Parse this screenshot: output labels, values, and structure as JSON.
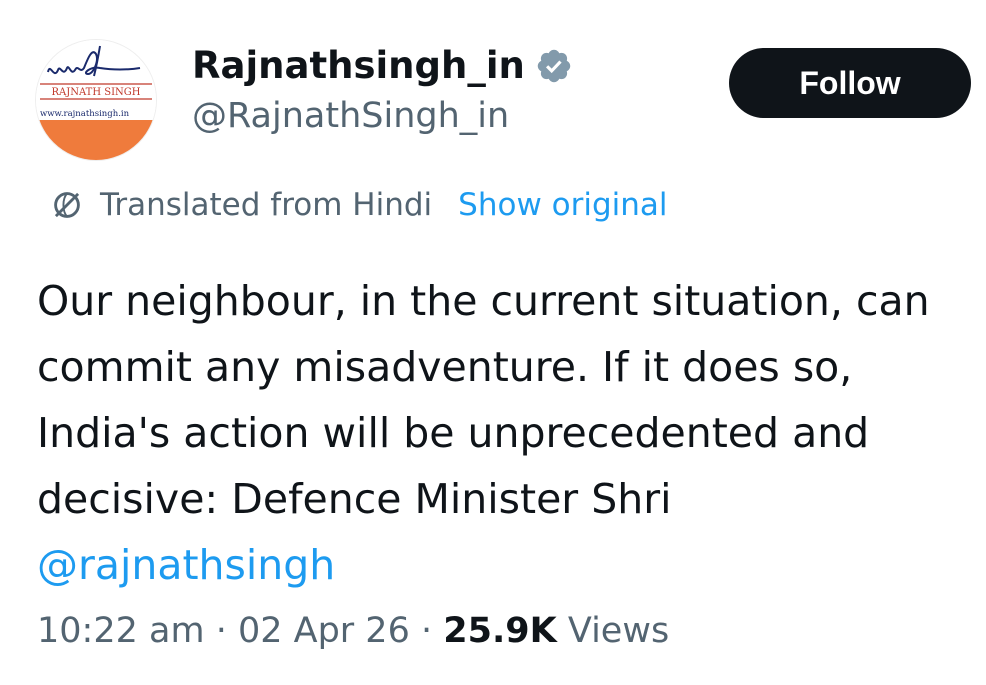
{
  "author": {
    "display_name": "Rajnathsingh_in",
    "handle": "@RajnathSingh_in",
    "verified": true,
    "avatar": {
      "logo_text": "RAJNATH SINGH",
      "url_text": "www.rajnathsingh.in",
      "brand_color": "#ef7b3c"
    }
  },
  "follow_button": {
    "label": "Follow"
  },
  "translation": {
    "note": "Translated from Hindi",
    "show_original_label": "Show original"
  },
  "tweet": {
    "text": "Our neighbour, in the current situation, can commit any misadventure. If it does so, India's action will be unprecedented and decisive: Defence Minister Shri",
    "mention": "@rajnathsingh"
  },
  "meta": {
    "time": "10:22 am",
    "separator": "·",
    "date": "02 Apr 26",
    "views_count": "25.9K",
    "views_label": "Views"
  },
  "colors": {
    "text_primary": "#0f1419",
    "text_secondary": "#536471",
    "link": "#1d9bf0",
    "button_bg": "#0f1419"
  },
  "icons": {
    "verified": "verified-badge-icon",
    "translate": "globe-icon"
  }
}
